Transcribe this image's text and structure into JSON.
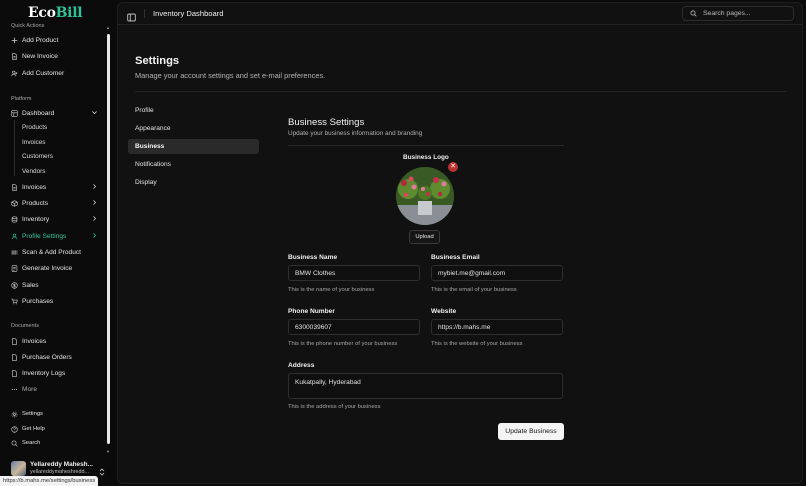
{
  "brand": {
    "part1": "Eco",
    "part2": "Bill"
  },
  "sidebar": {
    "quick_actions_label": "Quick Actions",
    "quick_actions": [
      {
        "label": "Add Product",
        "icon": "plus-icon"
      },
      {
        "label": "New Invoice",
        "icon": "file-icon"
      },
      {
        "label": "Add Customer",
        "icon": "user-plus-icon"
      }
    ],
    "platform_label": "Platform",
    "platform": [
      {
        "label": "Dashboard",
        "icon": "grid-icon",
        "expanded": true
      },
      {
        "label": "Invoices",
        "icon": "file-icon"
      },
      {
        "label": "Products",
        "icon": "box-icon"
      },
      {
        "label": "Inventory",
        "icon": "database-icon"
      },
      {
        "label": "Profile Settings",
        "icon": "user-icon",
        "active": true
      },
      {
        "label": "Scan & Add Product",
        "icon": "barcode-icon"
      },
      {
        "label": "Generate Invoice",
        "icon": "receipt-icon"
      },
      {
        "label": "Sales",
        "icon": "dollar-icon"
      },
      {
        "label": "Purchases",
        "icon": "cart-icon"
      }
    ],
    "dashboard_sub": [
      "Products",
      "Invoices",
      "Customers",
      "Vendors"
    ],
    "documents_label": "Documents",
    "documents": [
      {
        "label": "Invoices",
        "icon": "file-icon"
      },
      {
        "label": "Purchase Orders",
        "icon": "file-icon"
      },
      {
        "label": "Inventory Logs",
        "icon": "file-icon"
      },
      {
        "label": "More",
        "icon": "more-icon"
      }
    ],
    "footer": [
      {
        "label": "Settings",
        "icon": "gear-icon"
      },
      {
        "label": "Get Help",
        "icon": "help-icon"
      },
      {
        "label": "Search",
        "icon": "search-icon"
      }
    ],
    "user": {
      "name": "Yellareddy Mahesh...",
      "email": "yellareddymaheshredd..."
    }
  },
  "status_url": "https://b.mahs.me/settings/business",
  "topbar": {
    "title": "Inventory Dashboard",
    "search_placeholder": "Search pages..."
  },
  "settings": {
    "title": "Settings",
    "subtitle": "Manage your account settings and set e-mail preferences.",
    "tabs": [
      "Profile",
      "Appearance",
      "Business",
      "Notifications",
      "Display"
    ],
    "active_tab": "Business"
  },
  "business": {
    "title": "Business Settings",
    "subtitle": "Update your business information and branding",
    "logo_label": "Business Logo",
    "remove_symbol": "✕",
    "upload_label": "Upload",
    "fields": {
      "name": {
        "label": "Business Name",
        "value": "BMW Clothes",
        "help": "This is the name of your business"
      },
      "email": {
        "label": "Business Email",
        "value": "mybiet.me@gmail.com",
        "help": "This is the email of your business"
      },
      "phone": {
        "label": "Phone Number",
        "value": "6300039607",
        "help": "This is the phone number of your business"
      },
      "website": {
        "label": "Website",
        "value": "https://b.mahs.me",
        "help": "This is the website of your business"
      },
      "address": {
        "label": "Address",
        "value": "Kukatpally, Hyderabad",
        "help": "This is the address of your business"
      }
    },
    "submit_label": "Update Business"
  },
  "colors": {
    "accent": "#2fc29a",
    "background": "#0b0b0b",
    "panel": "#111111",
    "danger": "#b73333"
  }
}
